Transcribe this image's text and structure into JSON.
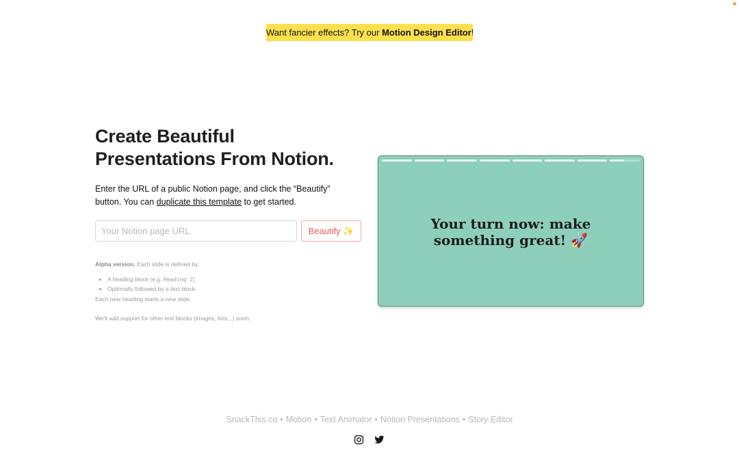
{
  "banner": {
    "text": "Want fancier effects? Try our ",
    "link_label": "Motion Design Editor",
    "suffix": "!",
    "background": "#fde04d"
  },
  "hero": {
    "title_line1": "Create Beautiful",
    "title_line2": "Presentations From Notion.",
    "intro_part1": "Enter the URL of a public Notion page, and click the “Beautify” button. You can ",
    "intro_link": "duplicate this template",
    "intro_part2": " to get started."
  },
  "form": {
    "url_placeholder": "Your Notion page URL",
    "url_value": "",
    "beautify_label": "Beautify ✨",
    "accent": "#e85c5c"
  },
  "notes": {
    "alpha_label": "Alpha version.",
    "alpha_text": " Each slide is defined by:",
    "bullet1_prefix": "A heading block (e.g. ",
    "bullet1_code": "Heading 2",
    "bullet1_suffix": ")",
    "bullet2": "Optionally followed by a text block",
    "line_after": "Each new heading starts a new slide.",
    "footer_note": "We'll add support for other text blocks (images, lists...) soon."
  },
  "slide": {
    "line1": "Your turn now: make",
    "line2": "something great! 🚀",
    "background": "#8ecfbc"
  },
  "footer": {
    "links": [
      "SnackThis.co",
      "Motion",
      "Text Animator",
      "Notion Presentations",
      "Story Editor"
    ],
    "separator": "•",
    "social_icons": [
      "instagram-icon",
      "twitter-icon"
    ]
  }
}
